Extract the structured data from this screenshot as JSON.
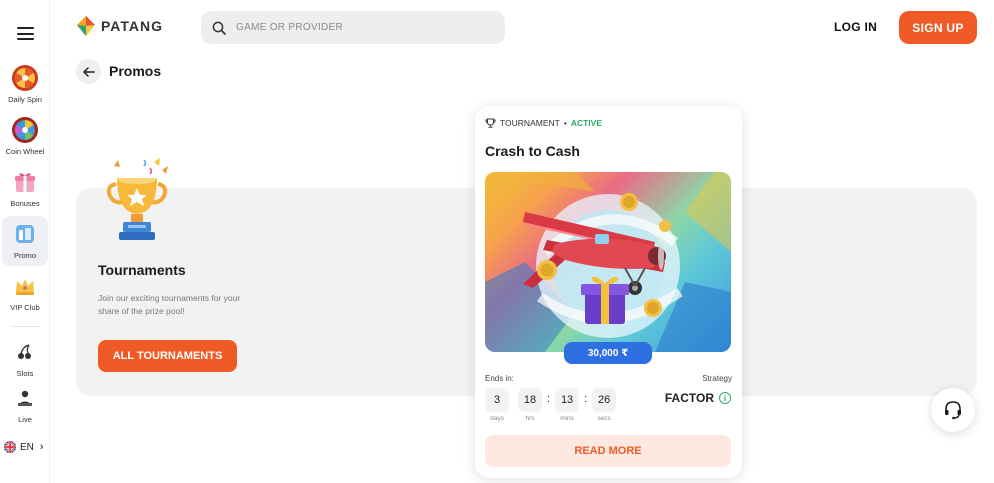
{
  "brand": {
    "name": "PATANG",
    "accent": "#f05a26"
  },
  "header": {
    "search_placeholder": "GAME OR PROVIDER",
    "login_label": "LOG IN",
    "signup_label": "SIGN UP"
  },
  "sidebar": {
    "items": [
      {
        "label": "Daily Spin",
        "icon": "wheel-icon"
      },
      {
        "label": "Coin Wheel",
        "icon": "coin-wheel-icon"
      },
      {
        "label": "Bonuses",
        "icon": "gift-icon"
      },
      {
        "label": "Promo",
        "icon": "promo-icon",
        "active": true
      },
      {
        "label": "VIP Club",
        "icon": "crown-icon"
      },
      {
        "label": "Slots",
        "icon": "cherry-icon"
      },
      {
        "label": "Live",
        "icon": "dealer-icon"
      }
    ],
    "language": "EN"
  },
  "page": {
    "title": "Promos"
  },
  "tournaments": {
    "title": "Tournaments",
    "description": "Join our exciting tournaments for your share of the prize pool!",
    "button_label": "ALL TOURNAMENTS"
  },
  "card": {
    "type_label": "TOURNAMENT",
    "separator": "•",
    "status": "ACTIVE",
    "title": "Crash to Cash",
    "prize": "30,000 ₹",
    "ends_label": "Ends in:",
    "strategy_label": "Strategy",
    "strategy_value": "FACTOR",
    "timer": [
      {
        "value": "3",
        "unit": "days"
      },
      {
        "value": "18",
        "unit": "hrs"
      },
      {
        "value": "13",
        "unit": "mins"
      },
      {
        "value": "26",
        "unit": "secs"
      }
    ],
    "timer_sep": ":",
    "read_more_label": "READ MORE"
  }
}
